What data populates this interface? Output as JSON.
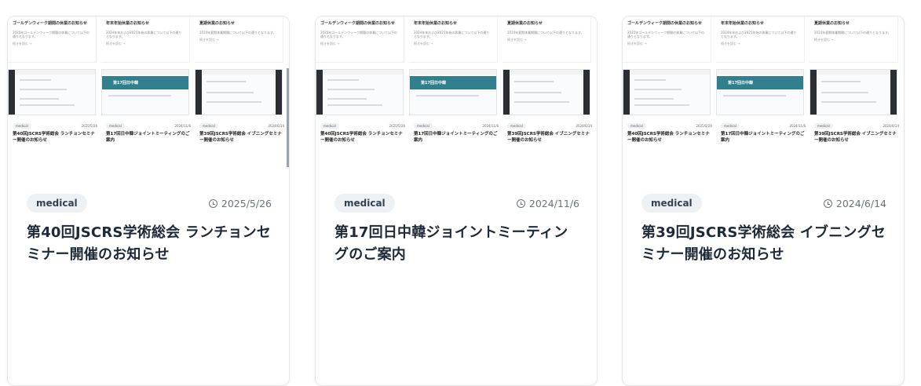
{
  "cards": [
    {
      "tag": "medical",
      "date": "2025/5/26",
      "title": "第40回JSCRS学術総会 ランチョンセミナー開催のお知らせ",
      "preview_top": [
        {
          "title": "ゴールデンウィーク期間の休業のお知らせ",
          "desc": "2025年ゴールデンウィーク期間の休業について以下の通りとなります。",
          "more": "続きを読む →"
        },
        {
          "title": "年末年始休業のお知らせ",
          "desc": "2024年末および2025年始の休業について以下の通りとなります。",
          "more": "続きを読む →"
        },
        {
          "title": "夏期休業のお知らせ",
          "desc": "2024年夏期休業期間について以下の通りとなります。",
          "more": "続きを読む →"
        }
      ],
      "preview_bottom": [
        {
          "badge": "medical",
          "date": "2025/5/26",
          "title": "第40回JSCRS学術総会 ランチョンセミナー開催のお知らせ"
        },
        {
          "badge": "medical",
          "date": "2024/11/6",
          "title": "第17回日中韓ジョイントミーティングのご案内",
          "banner": "第17回日中韓"
        },
        {
          "badge": "medical",
          "date": "2024/6/14",
          "title": "第39回JSCRS学術総会 イブニングセミナー開催のお知らせ"
        }
      ]
    },
    {
      "tag": "medical",
      "date": "2024/11/6",
      "title": "第17回日中韓ジョイントミーティングのご案内",
      "preview_top": [
        {
          "title": "ゴールデンウィーク期間の休業のお知らせ",
          "desc": "2025年ゴールデンウィーク期間の休業について以下の通りとなります。",
          "more": "続きを読む →"
        },
        {
          "title": "年末年始休業のお知らせ",
          "desc": "2024年末および2025年始の休業について以下の通りとなります。",
          "more": "続きを読む →"
        },
        {
          "title": "夏期休業のお知らせ",
          "desc": "2024年夏期休業期間について以下の通りとなります。",
          "more": "続きを読む →"
        }
      ],
      "preview_bottom": [
        {
          "badge": "medical",
          "date": "2025/5/26",
          "title": "第40回JSCRS学術総会 ランチョンセミナー開催のお知らせ"
        },
        {
          "badge": "medical",
          "date": "2024/11/6",
          "title": "第17回日中韓ジョイントミーティングのご案内",
          "banner": "第17回日中韓"
        },
        {
          "badge": "medical",
          "date": "2024/6/14",
          "title": "第39回JSCRS学術総会 イブニングセミナー開催のお知らせ"
        }
      ]
    },
    {
      "tag": "medical",
      "date": "2024/6/14",
      "title": "第39回JSCRS学術総会 イブニングセミナー開催のお知らせ",
      "preview_top": [
        {
          "title": "ゴールデンウィーク期間の休業のお知らせ",
          "desc": "2025年ゴールデンウィーク期間の休業について以下の通りとなります。",
          "more": "続きを読む →"
        },
        {
          "title": "年末年始休業のお知らせ",
          "desc": "2024年末および2025年始の休業について以下の通りとなります。",
          "more": "続きを読む →"
        },
        {
          "title": "夏期休業のお知らせ",
          "desc": "2024年夏期休業期間について以下の通りとなります。",
          "more": "続きを読む →"
        }
      ],
      "preview_bottom": [
        {
          "badge": "medical",
          "date": "2025/5/26",
          "title": "第40回JSCRS学術総会 ランチョンセミナー開催のお知らせ"
        },
        {
          "badge": "medical",
          "date": "2024/11/6",
          "title": "第17回日中韓ジョイントミーティングのご案内",
          "banner": "第17回日中韓"
        },
        {
          "badge": "medical",
          "date": "2024/6/14",
          "title": "第39回JSCRS学術総会 イブニングセミナー開催のお知らせ"
        }
      ]
    }
  ],
  "icons": {
    "date": "clock-icon"
  },
  "colors": {
    "tag_bg": "#eef1f3",
    "banner": "#2f7f8e",
    "text": "#1f2937",
    "muted": "#6b7280"
  }
}
